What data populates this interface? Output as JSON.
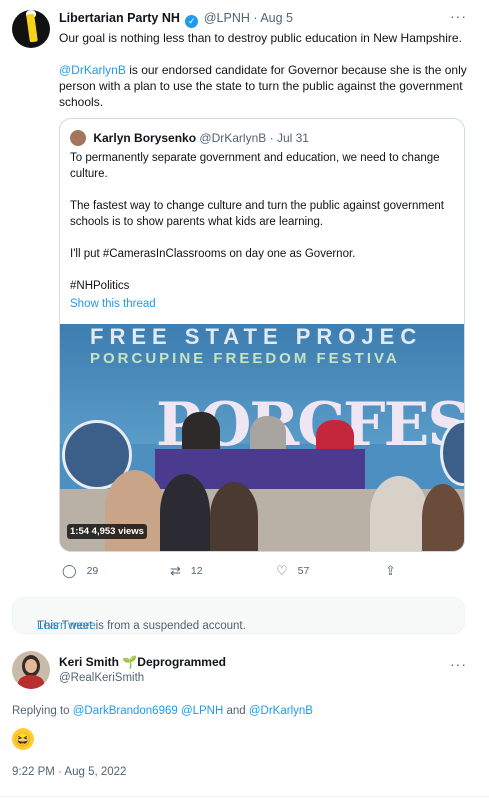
{
  "tweet": {
    "display_name": "Libertarian Party NH",
    "handle": "@LPNH",
    "date": "· Aug 5",
    "text_line1": "Our goal is nothing less than to destroy public education in New Hampshire.",
    "mention": "@DrKarlynB",
    "text_line2": " is our endorsed candidate for Governor because she is the only person with a plan to use the state to turn the public against the government schools.",
    "more_icon": "ellipsis-icon"
  },
  "quote": {
    "display_name": "Karlyn Borysenko",
    "handle": "@DrKarlynB",
    "date": "· Jul 31",
    "para1": "To permanently separate government and education, we need to change culture.",
    "para2": "The fastest way to change culture and turn the public against government schools is to show parents what kids are learning.",
    "para3": "I'll put #CamerasInClassrooms on day one as Governor.",
    "para4": "#NHPolitics",
    "show_thread": "Show this thread",
    "video": {
      "banner_line1": "FREE STATE PROJEC",
      "banner_line2": "PORCUPINE FREEDOM FESTIVA",
      "sign": "PORCFEST",
      "duration": "1:54",
      "views": "4,953 views"
    }
  },
  "actions": {
    "replies": "29",
    "retweets": "12",
    "likes": "57"
  },
  "suspended": {
    "text": "This Tweet is from a suspended account.",
    "link": "Learn more"
  },
  "reply": {
    "display_name": "Keri Smith 🌱Deprogrammed",
    "handle": "@RealKeriSmith",
    "replying_prefix": "Replying to ",
    "replying_to": "@DarkBrandon6969 @LPNH",
    "replying_and": " and ",
    "replying_last": "@DrKarlynB",
    "emoji": "😆",
    "timestamp": "9:22 PM · Aug 5, 2022"
  },
  "colors": {
    "accent": "#1d9bf0",
    "muted": "#536471",
    "border": "#cfd9de"
  }
}
